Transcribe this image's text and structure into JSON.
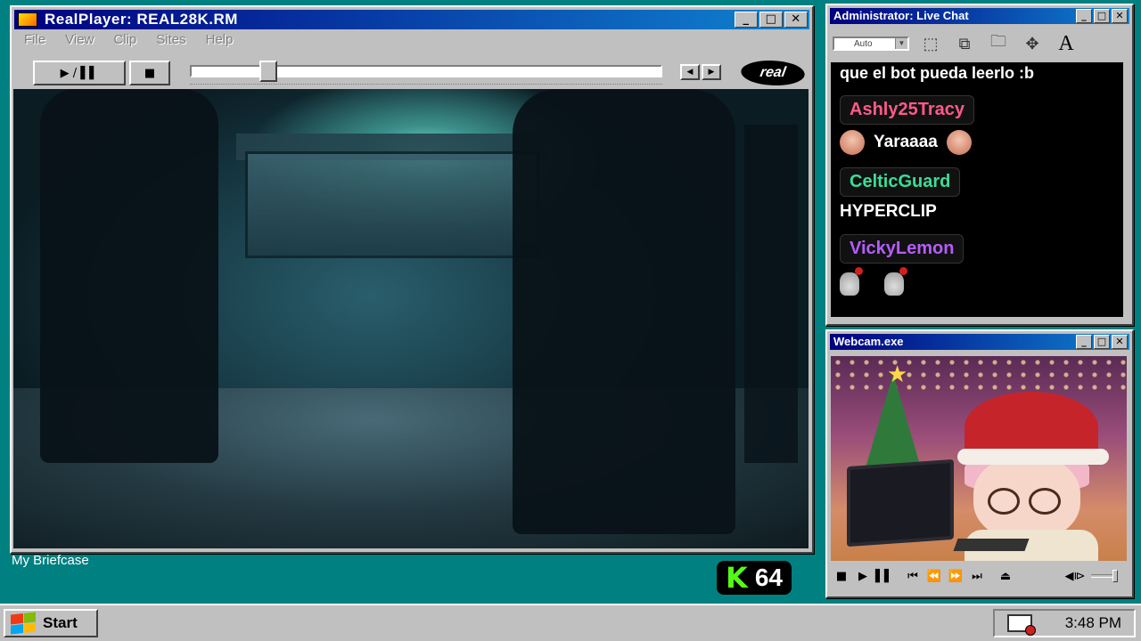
{
  "realplayer": {
    "title": "RealPlayer: REAL28K.RM",
    "menu": [
      "File",
      "View",
      "Clip",
      "Sites",
      "Help"
    ],
    "play_pause_label": "▶ / ▌▌",
    "stop_label": "■",
    "prev_label": "◀",
    "next_label": "▶",
    "logo_text": "real",
    "progress_fraction": 0.15
  },
  "chat": {
    "title": "Administrator: Live Chat",
    "font_size_select": "Auto",
    "tool_font_label": "A",
    "first_line": "que el bot pueda leerlo :b",
    "messages": [
      {
        "user": "Ashly25Tracy",
        "color": "#ff5a8a",
        "text": "Yaraaaa"
      },
      {
        "user": "CelticGuard",
        "color": "#3ddc97",
        "text": "HYPERCLIP"
      },
      {
        "user": "VickyLemon",
        "color": "#b65cff",
        "text": ""
      }
    ]
  },
  "webcam": {
    "title": "Webcam.exe",
    "controls": [
      "■",
      "▶",
      "▌▌",
      "⏮",
      "⏪",
      "⏩",
      "⏭",
      "⏏"
    ],
    "volume_icon": "◀⧐"
  },
  "desktop": {
    "briefcase_label": "My Briefcase",
    "kick_logo": "K",
    "kick_count": "64"
  },
  "taskbar": {
    "start_label": "Start",
    "clock": "3:48 PM"
  },
  "colors": {
    "desktop": "#008080",
    "titlebar": "#000080",
    "kick_green": "#53fc18"
  }
}
